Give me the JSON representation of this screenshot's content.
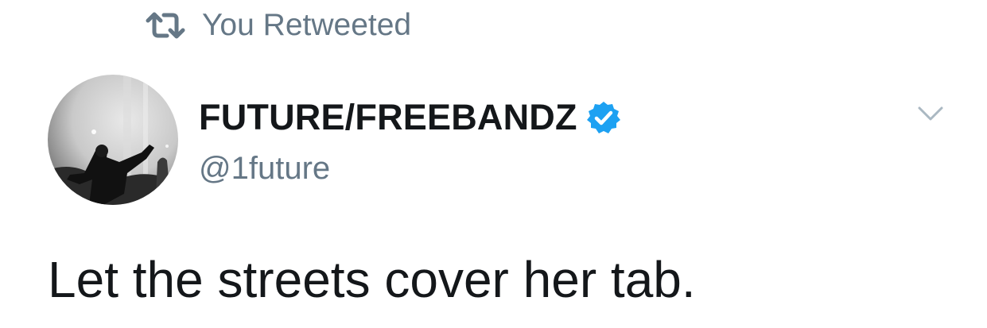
{
  "retweet_context": {
    "icon": "retweet-icon",
    "label": "You Retweeted"
  },
  "author": {
    "avatar": "profile-photo",
    "display_name": "FUTURE/FREEBANDZ",
    "verified": true,
    "verified_icon": "verified-badge-icon",
    "handle": "@1future"
  },
  "menu": {
    "icon": "chevron-down-icon"
  },
  "tweet": {
    "text": "Let the streets cover her tab."
  },
  "colors": {
    "text_primary": "#14171a",
    "text_secondary": "#657786",
    "verified_blue": "#1da1f2",
    "background": "#ffffff"
  }
}
